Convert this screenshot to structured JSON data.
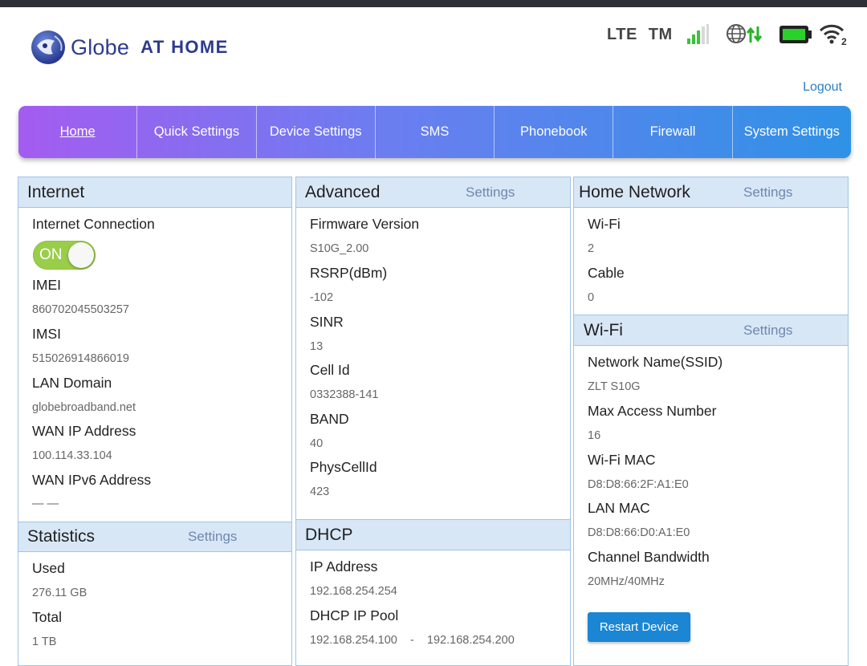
{
  "brand": {
    "name": "Globe",
    "tagline": "AT HOME"
  },
  "status": {
    "network_type": "LTE",
    "carrier": "TM",
    "wifi_clients": "2"
  },
  "header": {
    "logout": "Logout"
  },
  "nav": {
    "items": [
      "Home",
      "Quick Settings",
      "Device Settings",
      "SMS",
      "Phonebook",
      "Firewall",
      "System Settings"
    ],
    "active": "Home"
  },
  "internet": {
    "title": "Internet",
    "connection_label": "Internet Connection",
    "toggle": "ON",
    "fields": [
      {
        "label": "IMEI",
        "value": "860702045503257"
      },
      {
        "label": "IMSI",
        "value": "515026914866019"
      },
      {
        "label": "LAN Domain",
        "value": "globebroadband.net"
      },
      {
        "label": "WAN IP Address",
        "value": "100.114.33.104"
      },
      {
        "label": "WAN IPv6 Address",
        "value": "— —"
      }
    ]
  },
  "statistics": {
    "title": "Statistics",
    "settings": "Settings",
    "fields": [
      {
        "label": "Used",
        "value": "276.11 GB"
      },
      {
        "label": "Total",
        "value": "1 TB"
      }
    ]
  },
  "advanced": {
    "title": "Advanced",
    "settings": "Settings",
    "fields": [
      {
        "label": "Firmware Version",
        "value": "S10G_2.00"
      },
      {
        "label": "RSRP(dBm)",
        "value": "-102"
      },
      {
        "label": "SINR",
        "value": "13"
      },
      {
        "label": "Cell Id",
        "value": "0332388-141"
      },
      {
        "label": "BAND",
        "value": "40"
      },
      {
        "label": "PhysCellId",
        "value": "423"
      }
    ]
  },
  "dhcp": {
    "title": "DHCP",
    "fields": [
      {
        "label": "IP Address",
        "value": "192.168.254.254"
      },
      {
        "label": "DHCP IP Pool",
        "value": "192.168.254.100    -    192.168.254.200"
      }
    ]
  },
  "home_network": {
    "title": "Home Network",
    "settings": "Settings",
    "fields": [
      {
        "label": "Wi-Fi",
        "value": "2"
      },
      {
        "label": "Cable",
        "value": "0"
      }
    ]
  },
  "wifi": {
    "title": "Wi-Fi",
    "settings": "Settings",
    "fields": [
      {
        "label": "Network Name(SSID)",
        "value": "ZLT S10G"
      },
      {
        "label": "Max Access Number",
        "value": "16"
      },
      {
        "label": "Wi-Fi MAC",
        "value": "D8:D8:66:2F:A1:E0"
      },
      {
        "label": "LAN MAC",
        "value": "D8:D8:66:D0:A1:E0"
      },
      {
        "label": "Channel Bandwidth",
        "value": "20MHz/40MHz"
      }
    ],
    "restart": "Restart Device"
  },
  "colors": {
    "accent": "#1a86d4",
    "panel_header": "#d8e7f6",
    "panel_border": "#9ec5e8",
    "toggle_on": "#9acd4a",
    "battery": "#2bd12b",
    "signal": "#3cc23c"
  },
  "icons": [
    "globe-logo-icon",
    "signal-bars-icon",
    "globe-data-icon",
    "battery-icon",
    "wifi-icon"
  ]
}
